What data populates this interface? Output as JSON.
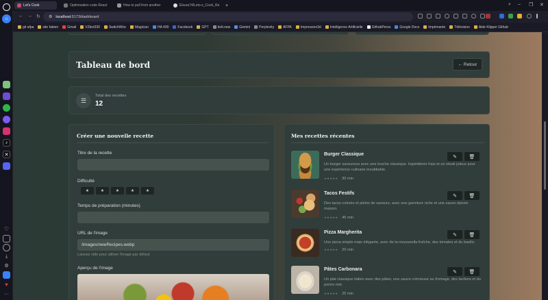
{
  "browser": {
    "tabs": [
      {
        "label": "Let's Cook",
        "active": true,
        "color": "#c0506a"
      },
      {
        "label": "Optimisation code React",
        "active": false,
        "color": "#777"
      },
      {
        "label": "How to pull from another",
        "active": false,
        "color": "#999"
      },
      {
        "label": "Elsura74/Lets-s_Cook_Re",
        "active": false,
        "color": "#ddd"
      }
    ],
    "url_host": "localhost",
    "url_path": ":5173/dashboard",
    "bookmarks": [
      {
        "label": "git afpa",
        "color": "#d6b04c"
      },
      {
        "label": "site fabien",
        "color": "#d6b04c"
      },
      {
        "label": "Gmail",
        "color": "#d44"
      },
      {
        "label": "VZbot330",
        "color": "#d6b04c"
      },
      {
        "label": "SwitchWire",
        "color": "#d6b04c"
      },
      {
        "label": "Magician",
        "color": "#d6b04c"
      },
      {
        "label": "HA 400",
        "color": "#4a8ad4"
      },
      {
        "label": "Facebook",
        "color": "#3b66c4"
      },
      {
        "label": "GPT",
        "color": "#d6b04c"
      },
      {
        "label": "bolt.new",
        "color": "#888"
      },
      {
        "label": "Gemini",
        "color": "#5a8de0"
      },
      {
        "label": "Perplexity",
        "color": "#888"
      },
      {
        "label": "AFPA",
        "color": "#d6b04c"
      },
      {
        "label": "Impression3d",
        "color": "#d6b04c"
      },
      {
        "label": "Intelligence Artificielle",
        "color": "#d6b04c"
      },
      {
        "label": "GithubPerso",
        "color": "#eee"
      },
      {
        "label": "Google Docs",
        "color": "#4a8ad4"
      },
      {
        "label": "Imprimante",
        "color": "#d6b04c"
      },
      {
        "label": "Télévision",
        "color": "#d6b04c"
      },
      {
        "label": "Aide Klipper Github",
        "color": "#d6b04c"
      }
    ]
  },
  "header": {
    "title": "Tableau de bord",
    "back_label": "← Retour"
  },
  "stats": {
    "label": "Total des recettes",
    "value": "12"
  },
  "form": {
    "title": "Créer une nouvelle recette",
    "title_label": "Titre de la recette",
    "difficulty_label": "Difficulté",
    "difficulty_stars": [
      "★",
      "★",
      "★",
      "★",
      "★"
    ],
    "prep_label": "Temps de préparation (minutes)",
    "image_label": "URL de l'image",
    "image_value": "/images/newRecipes.webp",
    "image_hint": "Laissez vide pour utiliser l'image par défaut",
    "preview_label": "Aperçu de l'image"
  },
  "recipes_panel": {
    "title": "Mes recettes récentes",
    "items": [
      {
        "name": "Burger Classique",
        "desc": "Un burger savoureux avec une touche classique. Ingrédients frais et un steak juteux pour une expérience culinaire inoubliable.",
        "time": "30 min",
        "stars": "★★★★★",
        "accent": "#b5712e"
      },
      {
        "name": "Tacos Festifs",
        "desc": "Des tacos colorés et pleins de saveurs, avec une garniture riche et une sauce épicée maison.",
        "time": "45 min",
        "stars": "★★★★★",
        "accent": "#c9a06a"
      },
      {
        "name": "Pizza Margherita",
        "desc": "Une pizza simple mais élégante, avec de la mozzarella fraîche, des tomates et du basilic.",
        "time": "20 min",
        "stars": "★★★★★",
        "accent": "#c2402a"
      },
      {
        "name": "Pâtes Carbonara",
        "desc": "Un plat classique italien avec des pâtes, une sauce crémeuse au fromage, des lardons et du poivre noir.",
        "time": "25 min",
        "stars": "★★★★★",
        "accent": "#d9cfb8"
      }
    ]
  }
}
